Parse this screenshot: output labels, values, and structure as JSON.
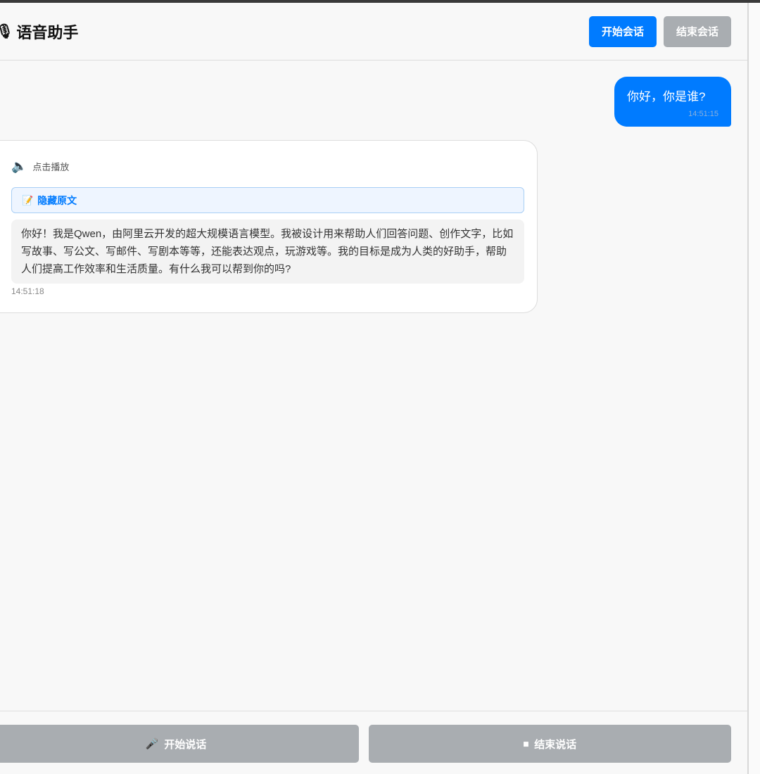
{
  "header": {
    "icon": "microphone-icon",
    "title": "语音助手",
    "start_session": "开始会话",
    "end_session": "结束会话"
  },
  "messages": {
    "user": {
      "text": "你好，你是谁?",
      "time": "14:51:15"
    },
    "bot": {
      "play_label": "点击播放",
      "toggle_label": "隐藏原文",
      "text": "你好！我是Qwen，由阿里云开发的超大规模语言模型。我被设计用来帮助人们回答问题、创作文字，比如写故事、写公文、写邮件、写剧本等等，还能表达观点，玩游戏等。我的目标是成为人类的好助手，帮助人们提高工作效率和生活质量。有什么我可以帮到你的吗?",
      "time": "14:51:18"
    }
  },
  "footer": {
    "start_speaking": "开始说话",
    "stop_speaking": "结束说话"
  },
  "colors": {
    "accent": "#007bff",
    "disabled": "#a9adb1"
  }
}
